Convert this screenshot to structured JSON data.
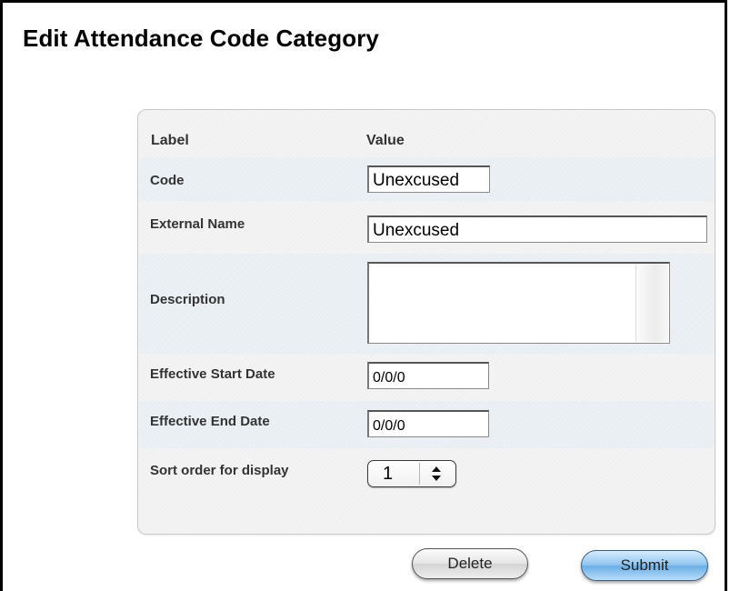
{
  "page": {
    "title": "Edit Attendance Code Category"
  },
  "table": {
    "header": {
      "label": "Label",
      "value": "Value"
    },
    "fields": {
      "code": {
        "label": "Code",
        "value": "Unexcused"
      },
      "external_name": {
        "label": "External Name",
        "value": "Unexcused"
      },
      "description": {
        "label": "Description",
        "value": ""
      },
      "effective_start_date": {
        "label": "Effective Start Date",
        "value": "0/0/0"
      },
      "effective_end_date": {
        "label": "Effective End Date",
        "value": "0/0/0"
      },
      "sort_order": {
        "label": "Sort order for display",
        "value": "1"
      }
    }
  },
  "buttons": {
    "delete": "Delete",
    "submit": "Submit"
  },
  "colors": {
    "alt_row": "#e7edf2",
    "submit_button": "#8fc4ee"
  },
  "icons": {
    "stepper": "up-down-arrows-icon"
  }
}
